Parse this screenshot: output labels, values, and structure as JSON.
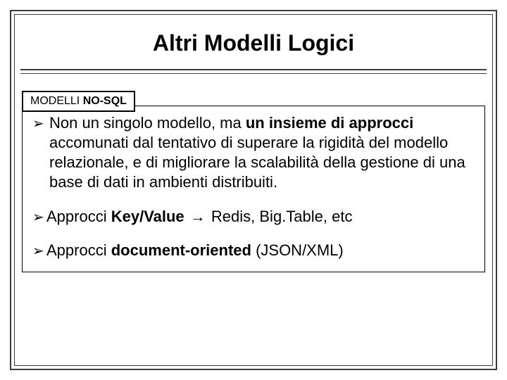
{
  "title": "Altri Modelli Logici",
  "label_prefix": "MODELLI ",
  "label_bold": "NO-SQL",
  "bullets": {
    "b1_pre": " Non un singolo modello, ma ",
    "b1_bold": "un insieme di approcci",
    "b1_post": " accomunati dal tentativo di superare la rigidità del modello relazionale, e di migliorare la scalabilità della gestione di una base di dati in ambienti distribuiti.",
    "b2_pre": "Approcci ",
    "b2_bold": "Key/Value",
    "b2_arrow": " → ",
    "b2_post": "Redis, Big.Table, etc",
    "b3_pre": "Approcci ",
    "b3_bold": "document-oriented",
    "b3_post": " (JSON/XML)"
  },
  "glyphs": {
    "bullet_arrow": "➢"
  }
}
